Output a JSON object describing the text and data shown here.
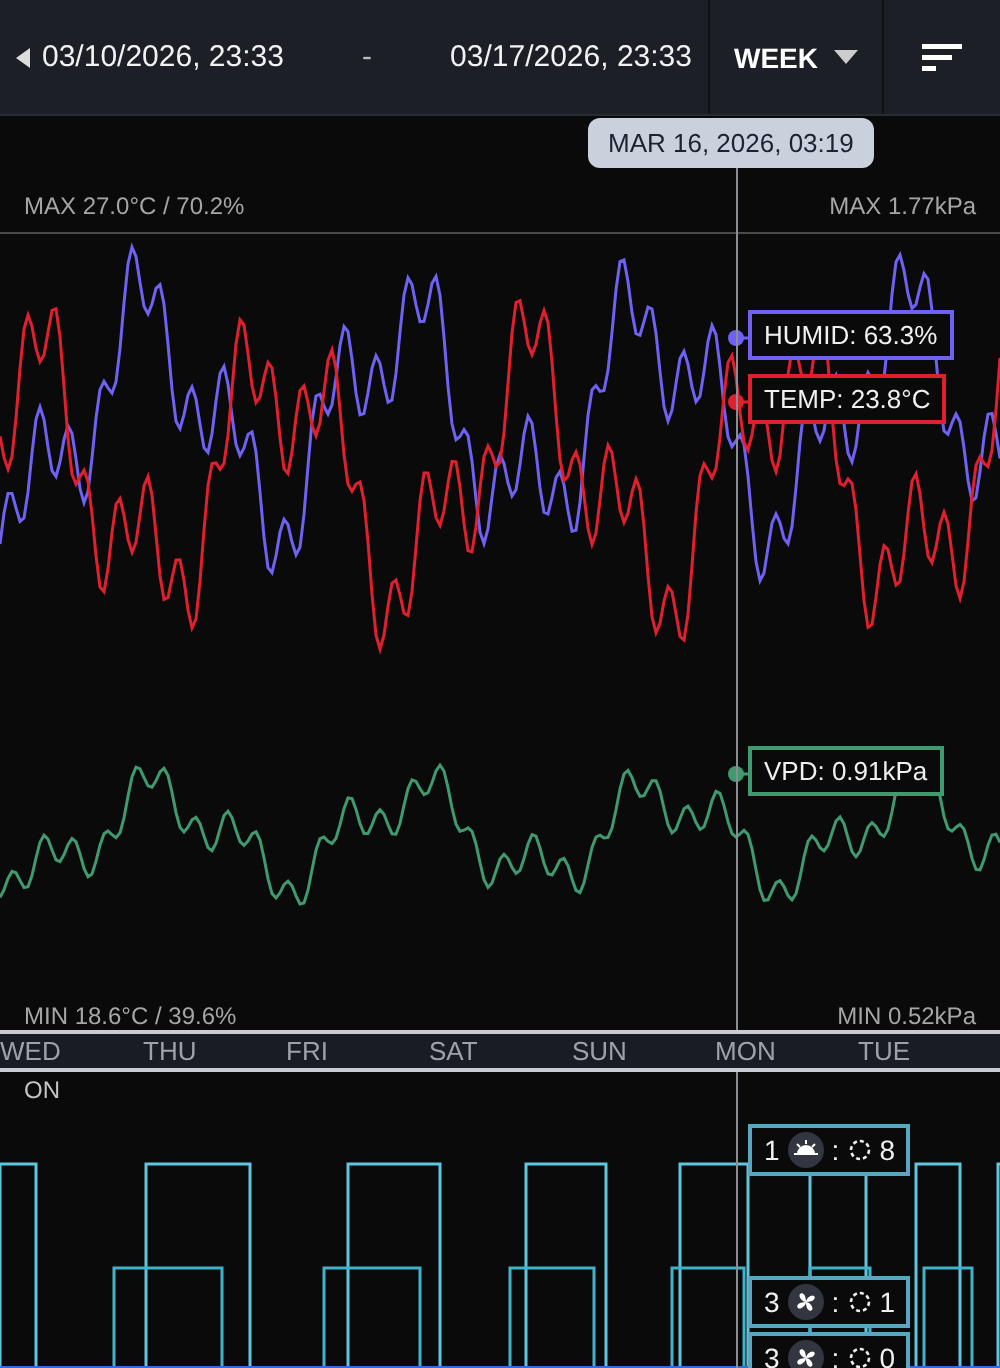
{
  "header": {
    "start": "03/10/2026, 23:33",
    "separator": "-",
    "end": "03/17/2026, 23:33",
    "range": "WEEK"
  },
  "cursor": {
    "label": "MAR 16, 2026, 03:19"
  },
  "env_chart": {
    "max_left": "MAX 27.0°C / 70.2%",
    "max_right": "MAX 1.77kPa",
    "min_left": "MIN 18.6°C / 39.6%",
    "min_right": "MIN 0.52kPa",
    "readouts": [
      {
        "kind": "humid",
        "text": "HUMID: 63.3%",
        "color": "#6f62f2"
      },
      {
        "kind": "temp",
        "text": "TEMP: 23.8°C",
        "color": "#e0202e"
      },
      {
        "kind": "vpd",
        "text": "VPD: 0.91kPa",
        "color": "#3f9a70"
      }
    ]
  },
  "days": [
    "WED",
    "THU",
    "FRI",
    "SAT",
    "SUN",
    "MON",
    "TUE"
  ],
  "devices": {
    "state_label": "ON",
    "readouts": [
      {
        "number": "1",
        "kind": "light",
        "separator": ":",
        "value": "8"
      },
      {
        "number": "3",
        "kind": "fan",
        "separator": ":",
        "value": "1"
      },
      {
        "number": "3",
        "kind": "fan",
        "separator": ":",
        "value": "0"
      }
    ]
  }
}
